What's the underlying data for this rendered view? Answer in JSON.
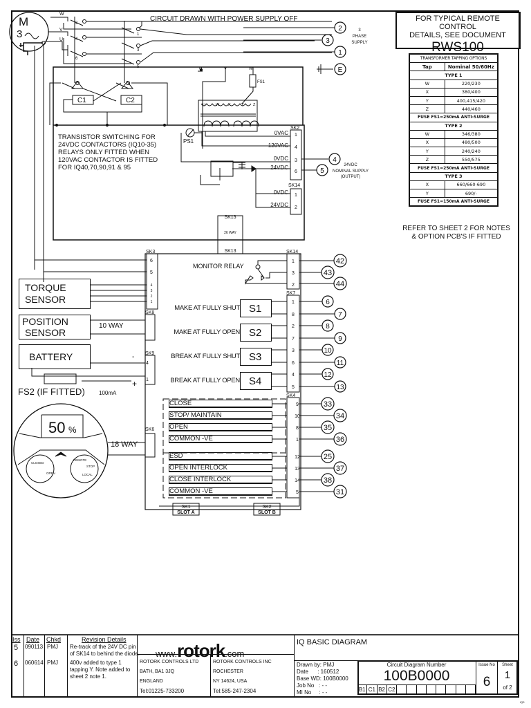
{
  "header_note": "CIRCUIT DRAWN WITH POWER SUPPLY OFF",
  "remote_control_box": {
    "line1": "FOR TYPICAL REMOTE CONTROL",
    "line2": "DETAILS, SEE DOCUMENT",
    "document": "RWS100"
  },
  "tapping_table": {
    "caption": "TRANSFORMER TAPPING OPTIONS",
    "headers": [
      "Tap",
      "Nominal 50/60Hz"
    ],
    "groups": [
      {
        "type": "TYPE 1",
        "rows": [
          [
            "W",
            "220/230"
          ],
          [
            "X",
            "380/400"
          ],
          [
            "Y",
            "400,415/420"
          ],
          [
            "Z",
            "440/460"
          ]
        ],
        "fuse": "FUSE FS1=250mA ANTI-SURGE"
      },
      {
        "type": "TYPE 2",
        "rows": [
          [
            "W",
            "346/380"
          ],
          [
            "X",
            "480/500"
          ],
          [
            "Y",
            "240/240"
          ],
          [
            "Z",
            "550/575"
          ]
        ],
        "fuse": "FUSE FS1=250mA ANTI-SURGE"
      },
      {
        "type": "TYPE 3",
        "rows": [
          [
            "X",
            "660/660-690"
          ],
          [
            "Y",
            "690/-"
          ]
        ],
        "fuse": "FUSE FS1=150mA ANTI-SURGE"
      }
    ]
  },
  "refer_note": {
    "line1": "REFER TO SHEET 2 FOR NOTES",
    "line2": "& OPTION PCB'S IF FITTED"
  },
  "motor": {
    "label": "M",
    "phase": "3",
    "terminals": [
      "W",
      "V",
      "U"
    ]
  },
  "contactor": {
    "contacts": [
      "2",
      "1",
      "4",
      "3",
      "6",
      "5"
    ],
    "coils": [
      "C1",
      "C2"
    ]
  },
  "supply": {
    "terminals": [
      "2",
      "3",
      "1",
      "E"
    ],
    "label_lines": [
      "3",
      "PHASE",
      "SUPPLY"
    ]
  },
  "transformer": {
    "inputs": [
      "U",
      "V",
      "W"
    ],
    "taps": [
      "U",
      "W",
      "X",
      "Y",
      "Z"
    ],
    "fuse": "FS1",
    "ps": "PS1"
  },
  "transistor_note": [
    "TRANSISTOR SWITCHING FOR",
    "24VDC CONTACTORS (IQ10-35)",
    "RELAYS ONLY FITTED WHEN",
    "120VAC CONTACTOR IS FITTED",
    "FOR IQ40,70,90,91 & 95"
  ],
  "sk2": {
    "label": "SK2",
    "pins": [
      {
        "name": "0VAC",
        "pin": "1"
      },
      {
        "name": "120VAC",
        "pin": "4"
      },
      {
        "name": "0VDC",
        "pin": "3"
      },
      {
        "name": "24VDC",
        "pin": "6"
      }
    ]
  },
  "sk14_power": {
    "label": "SK14",
    "pins": [
      {
        "name": "0VDC",
        "pin": "1"
      },
      {
        "name": "24VDC",
        "pin": "2"
      }
    ]
  },
  "nominal_supply": {
    "terminals": [
      "4",
      "5"
    ],
    "label_lines": [
      "24VDC",
      "NOMINAL SUPPLY",
      "(OUTPUT)"
    ]
  },
  "sk13": {
    "top": "SK13",
    "mid": "26 WAY",
    "bottom": "SK13"
  },
  "sk3": {
    "label": "SK3",
    "pins": [
      "6",
      "5",
      "4",
      "3",
      "2",
      "1"
    ]
  },
  "monitor_relay": {
    "label": "MONITOR RELAY",
    "connector": "SK14",
    "pins": [
      "1",
      "3",
      "2"
    ],
    "terminals": [
      "42",
      "43",
      "44"
    ]
  },
  "torque_sensor": {
    "line1": "TORQUE",
    "line2": "SENSOR"
  },
  "position_sensor": {
    "line1": "POSITION",
    "line2": "SENSOR",
    "cable": "10 WAY",
    "connector": "SK8"
  },
  "battery": {
    "label": "BATTERY",
    "connector": "SK9",
    "pins": [
      "4",
      "1"
    ],
    "minus": "-",
    "plus": "+",
    "fuse": "FS2 (IF FITTED)",
    "fuse_rating": "100mA"
  },
  "sk7": {
    "label": "SK7",
    "switches": [
      {
        "desc": "MAKE AT FULLY SHUT",
        "name": "S1",
        "pins": [
          "1",
          "8"
        ],
        "terminals": [
          "6",
          "7"
        ]
      },
      {
        "desc": "MAKE AT FULLY OPEN",
        "name": "S2",
        "pins": [
          "2",
          "7"
        ],
        "terminals": [
          "8",
          "9"
        ]
      },
      {
        "desc": "BREAK AT FULLY SHUT",
        "name": "S3",
        "pins": [
          "3",
          "6"
        ],
        "terminals": [
          "10",
          "11"
        ]
      },
      {
        "desc": "BREAK AT FULLY OPEN",
        "name": "S4",
        "pins": [
          "4",
          "5"
        ],
        "terminals": [
          "12",
          "13"
        ]
      }
    ]
  },
  "sk4": {
    "label": "SK4",
    "inputs": [
      {
        "label": "CLOSE",
        "pin": "9",
        "terminal": "33"
      },
      {
        "label": "STOP/ MAINTAIN",
        "pin": "10",
        "terminal": "34"
      },
      {
        "label": "OPEN",
        "pin": "8",
        "terminal": "35"
      },
      {
        "label": "COMMON -VE",
        "pin": "1",
        "terminal": "36"
      },
      {
        "label": "ESD",
        "pin": "12",
        "terminal": "25"
      },
      {
        "label": "OPEN INTERLOCK",
        "pin": "13",
        "terminal": "37"
      },
      {
        "label": "CLOSE INTERLOCK",
        "pin": "14",
        "terminal": "38"
      },
      {
        "label": "COMMON -VE",
        "pin": "5",
        "terminal": "31"
      }
    ]
  },
  "display": {
    "value": "50",
    "unit": "%",
    "cable": "18 WAY",
    "connector": "SK6",
    "left_knob": [
      "CLOSED",
      "OPEN"
    ],
    "right_knob": [
      "REMOTE",
      "STOP",
      "LOCAL"
    ]
  },
  "slots": [
    {
      "sk": "SK1",
      "slot": "SLOT A"
    },
    {
      "sk": "SK2",
      "slot": "SLOT B"
    }
  ],
  "title_block": {
    "rev_headers": [
      "Iss",
      "Date",
      "Chkd",
      "Revision Details"
    ],
    "revisions": [
      {
        "iss": "5",
        "date": "090113",
        "chkd": "PMJ",
        "details": [
          "Re-track of the 24V DC pin",
          "of SK14 to behind the diode."
        ]
      },
      {
        "iss": "6",
        "date": "060614",
        "chkd": "PMJ",
        "details": [
          "400v added to type 1",
          "tapping Y. Note added to",
          "sheet 2 note 1."
        ]
      }
    ],
    "logo_prefix": "www.",
    "logo_brand": "rotork",
    "logo_suffix": ".com",
    "uk_address": [
      "ROTORK CONTROLS LTD",
      "BATH, BA1 3JQ",
      "ENGLAND",
      "Tel:01225-733200"
    ],
    "us_address": [
      "ROTORK CONTROLS INC",
      "ROCHESTER",
      "NY 14624, USA",
      "Tel:585-247-2304"
    ],
    "diagram_title": "IQ BASIC DIAGRAM",
    "drawn_by": "Drawn by: PMJ",
    "date": "Date      : 160512",
    "base_wd": "Base WD: 100B0000",
    "job_no": "Job No   : - -",
    "mi_no": "MI No     : - -",
    "cdn_label": "Circuit Diagram Number",
    "cdn": "100B0000",
    "grid": [
      "B1",
      "C1",
      "B2",
      "C2",
      "",
      "",
      "",
      "",
      "",
      "",
      "",
      ""
    ],
    "issue_label": "Issue No",
    "issue": "6",
    "sheet_label": "Sheet",
    "sheet": "1",
    "of": "of 2",
    "corner_code": "IQ3"
  }
}
